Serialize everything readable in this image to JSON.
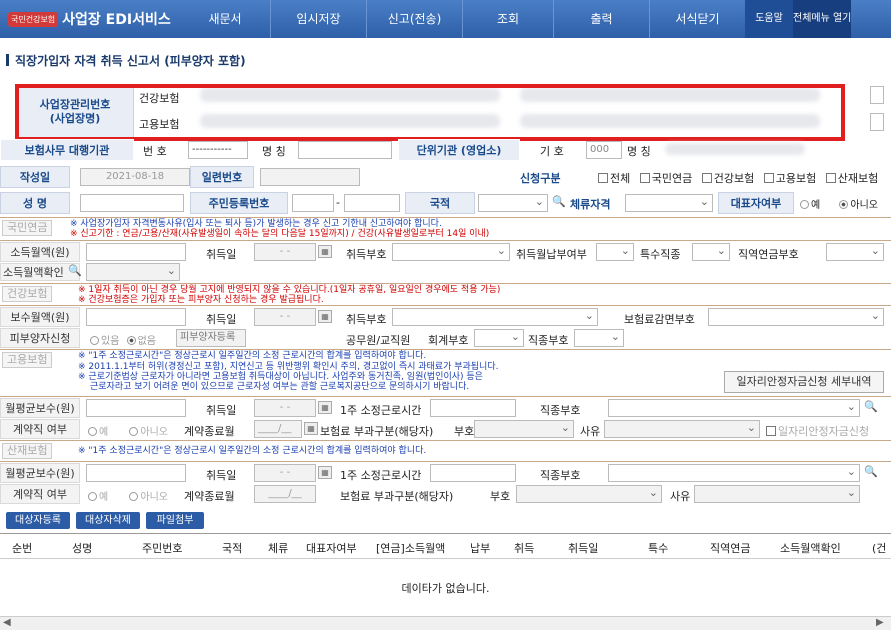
{
  "nav": {
    "logo_mark": "국민건강보험",
    "title": "사업장 EDI서비스",
    "items": [
      "새문서",
      "임시저장",
      "신고(전송)",
      "조회",
      "출력",
      "서식닫기"
    ],
    "help": "도움말",
    "fullmenu": "전체메뉴 열기"
  },
  "page_title": "직장가입자 자격 취득 신고서 (피부양자 포함)",
  "biz": {
    "label": "사업장관리번호\n(사업장명)",
    "health": "건강보험",
    "employ": "고용보험"
  },
  "agency": {
    "label": "보험사무 대행기관",
    "num": "번 호",
    "num_val": "-----------",
    "name": "명 칭",
    "unit": "단위기관 (영업소)",
    "code": "기 호",
    "code_val": "000",
    "name2": "명 칭"
  },
  "row1": {
    "date_label": "작성일",
    "date_val": "2021-08-18",
    "serial": "일련번호",
    "apply": "신청구분",
    "checks": [
      "전체",
      "국민연금",
      "건강보험",
      "고용보험",
      "산재보험"
    ]
  },
  "row2": {
    "name": "성 명",
    "rrn": "주민등록번호",
    "nation": "국적",
    "stay": "체류자격",
    "rep": "대표자여부",
    "yes": "예",
    "no": "아니오"
  },
  "pension": {
    "tag": "국민연금",
    "note1": "※ 사업장가입자 자격변동사유(입사 또는 퇴사 등)가 발생하는 경우 신고 기한내 신고하여야 합니다.",
    "note2": "※ 신고기한 : 연금/고용/산재(사유발생일이 속하는 달의 다음달 15일까지) / 건강(사유발생일로부터 14일 이내)",
    "income": "소득월액(원)",
    "acq": "취득일",
    "acq_date": "-  -",
    "acq_code": "취득부호",
    "acq_month": "취득월납부여부",
    "special": "특수직종",
    "job_pension": "직역연금부호",
    "confirm": "소득월액확인"
  },
  "health": {
    "tag": "건강보험",
    "note1": "※ 1일자 취득이 아닌 경우 당월 고지에 반영되지 않을 수 있습니다.(1일자 공휴일, 일요일인 경우에도 적용 가능)",
    "note2": "※ 건강보험증은 가입자 또는 피부양자 신청하는 경우 발급됩니다.",
    "pay": "보수월액(원)",
    "acq": "취득일",
    "acq_date": "-  -",
    "acq_code": "취득부호",
    "reduce": "보험료감면부호",
    "dep": "피부양자신청",
    "has": "있음",
    "none": "없음",
    "dep_reg": "피부양자등록",
    "civil": "공무원/교직원",
    "acct": "회계부호",
    "jobcode": "직종부호"
  },
  "employ": {
    "tag": "고용보험",
    "note1": "※ \"1주 소정근로시간\"은 정상근로시 일주일간의 소정 근로시간의 합계를 입력하여야 합니다.",
    "note2": "※ 2011.1.1부터 허위(경정신고 포함), 지연신고 등 위반행위 확인시 주의, 경고없이 즉시 과태료가 부과됩니다.",
    "note3": "※ 근로기준법상 근로자가 아니라면 고용보험 취득대상이 아닙니다. 사업주와 동거친족, 임원(법인이사) 등은",
    "note4": "근로자라고 보기 어려운 면이 있으므로 근로자성 여부는 관할 근로복지공단으로 문의하시기 바랍니다.",
    "jobsupport": "일자리안정자금신청 세부내역",
    "avg": "월평균보수(원)",
    "acq": "취득일",
    "acq_date": "-  -",
    "hours": "1주 소정근로시간",
    "jobcode": "직종부호",
    "contract": "계약직 여부",
    "yes": "예",
    "no": "아니오",
    "end": "계약종료월",
    "end_val": "____/__",
    "burden": "보험료 부과구분(해당자)",
    "code": "부호",
    "reason": "사유",
    "jobsupport2": "일자리안정자금신청"
  },
  "industrial": {
    "tag": "산재보험",
    "note1": "※ \"1주 소정근로시간\"은 정상근로시 일주일간의 소정 근로시간의 합계를 입력하여야 합니다.",
    "avg": "월평균보수(원)",
    "acq": "취득일",
    "acq_date": "-  -",
    "hours": "1주 소정근로시간",
    "jobcode": "직종부호",
    "contract": "계약직 여부",
    "yes": "예",
    "no": "아니오",
    "end": "계약종료월",
    "end_val": "____/__",
    "burden": "보험료 부과구분(해당자)",
    "code": "부호",
    "reason": "사유"
  },
  "buttons": {
    "register": "대상자등록",
    "delete": "대상자삭제",
    "file": "파일첨부"
  },
  "grid": {
    "headers": [
      "순번",
      "성명",
      "주민번호",
      "국적",
      "체류",
      "대표자여부",
      "[연금]소득월액",
      "납부",
      "취득",
      "취득일",
      "특수",
      "직역연금",
      "소득월액확인",
      "(건"
    ],
    "empty": "데이타가 없습니다."
  }
}
